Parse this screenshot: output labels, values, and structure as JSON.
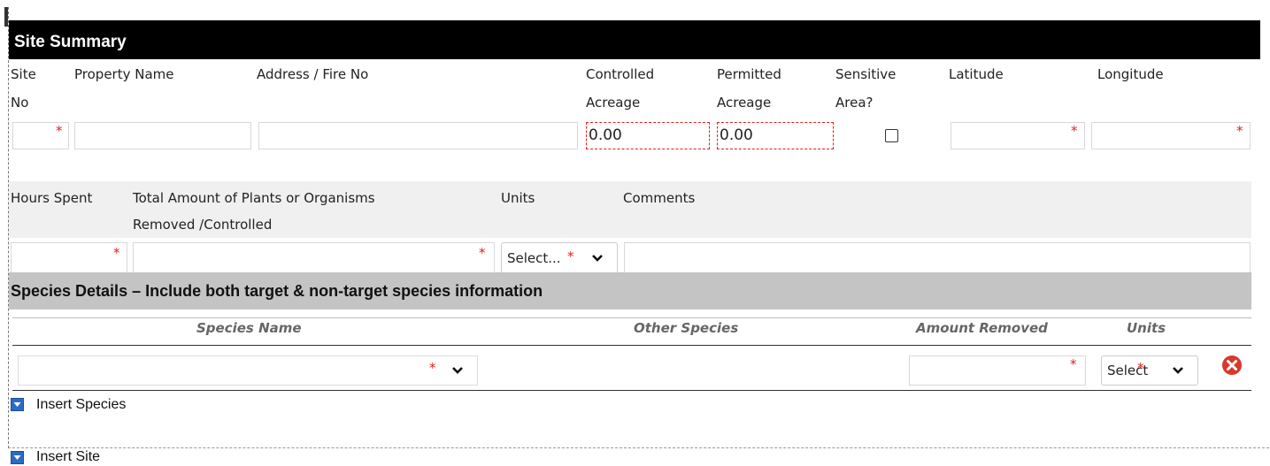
{
  "site_summary": {
    "title": "Site Summary",
    "labels": {
      "site_no_1": "Site",
      "site_no_2": "No",
      "property_name": "Property Name",
      "address": "Address / Fire No",
      "controlled_1": "Controlled",
      "controlled_2": "Acreage",
      "permitted_1": "Permitted",
      "permitted_2": "Acreage",
      "sensitive_1": "Sensitive",
      "sensitive_2": "Area?",
      "latitude": "Latitude",
      "longitude": "Longitude"
    },
    "values": {
      "site_no": "",
      "property_name": "",
      "address": "",
      "controlled_acreage": "0.00",
      "permitted_acreage": "0.00",
      "latitude": "",
      "longitude": ""
    },
    "sensitive_checked": false
  },
  "effort": {
    "labels": {
      "hours_spent": "Hours Spent",
      "total_1": "Total Amount of Plants or Organisms",
      "total_2": "Removed /Controlled",
      "units": "Units",
      "comments": "Comments"
    },
    "units_select": "Select...",
    "hours_spent": "",
    "total_amount": "",
    "comments": ""
  },
  "species": {
    "title": "Species Details – Include both target & non-target species information",
    "columns": {
      "species_name": "Species Name",
      "other_species": "Other Species",
      "amount_removed": "Amount Removed",
      "units": "Units"
    },
    "row": {
      "species_name": "",
      "amount_removed": "",
      "units_select": "Select"
    },
    "insert_species": "Insert Species"
  },
  "insert_site": "Insert Site",
  "required_marker": "*",
  "colors": {
    "required": "#e02020",
    "header_bg": "#000000",
    "species_band": "#c4c4c4",
    "delete_icon": "#d9382c",
    "insert_icon": "#2b6cc4"
  },
  "icons": [
    "chevron-down-icon",
    "delete-icon",
    "insert-arrow-icon",
    "checkbox"
  ]
}
